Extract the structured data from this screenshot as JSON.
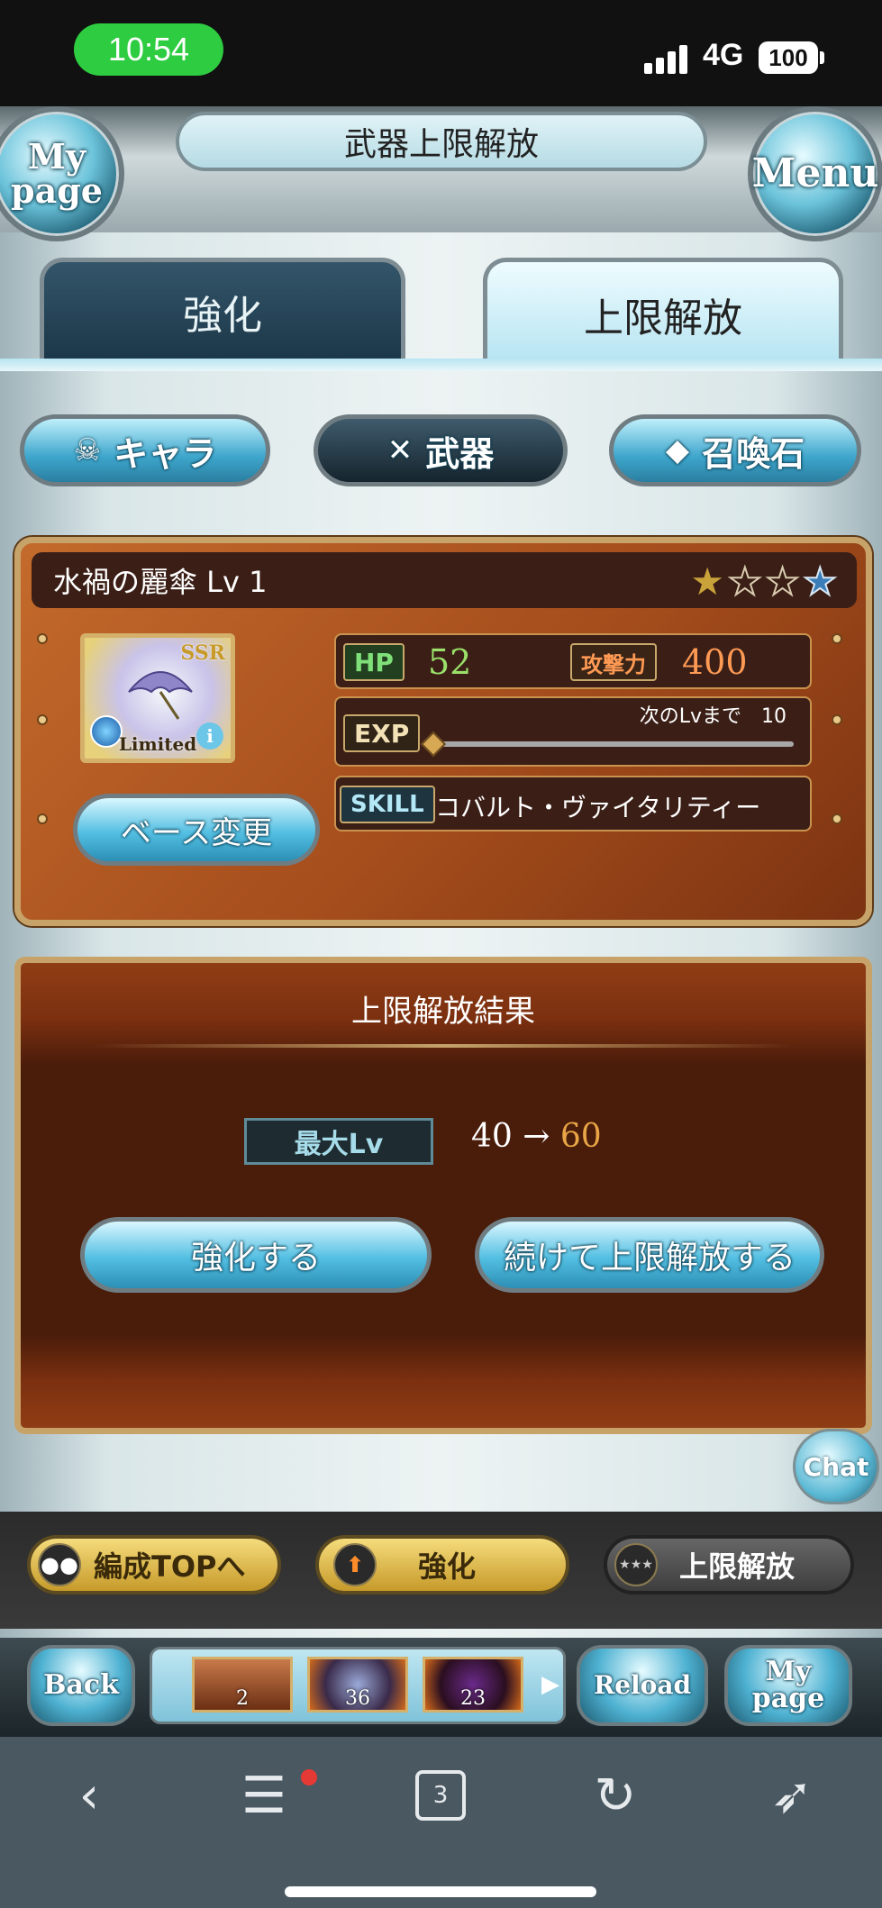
{
  "status": {
    "time": "10:54",
    "network": "4G",
    "battery": "100"
  },
  "header": {
    "title": "武器上限解放",
    "left_orb": "My page",
    "right_orb": "Menu"
  },
  "tabs": [
    {
      "label": "強化",
      "active": false
    },
    {
      "label": "上限解放",
      "active": true
    }
  ],
  "filters": [
    {
      "label": "キャラ",
      "icon": "chara-icon"
    },
    {
      "label": "武器",
      "icon": "crossed-swords-icon",
      "selected": true
    },
    {
      "label": "召喚石",
      "icon": "crystal-icon"
    }
  ],
  "weapon": {
    "name": "水禍の麗傘 Lv 1",
    "rarity_badge": "SSR",
    "limited_label": "Limited",
    "uncap_stars": {
      "filled": 1,
      "total": 4
    },
    "hp_label": "HP",
    "hp": "52",
    "atk_label": "攻撃力",
    "atk": "400",
    "exp_label": "EXP",
    "next_lv_text": "次のLvまで　10",
    "exp_progress": 0.0,
    "skill_label": "SKILL",
    "skill": "コバルト・ヴァイタリティー",
    "base_change_label": "ベース変更"
  },
  "result": {
    "title": "上限解放結果",
    "max_lv_label": "最大Lv",
    "lv_from": "40",
    "arrow": "→",
    "lv_to": "60",
    "enhance_button": "強化する",
    "continue_button": "続けて上限解放する"
  },
  "chat_label": "Chat",
  "bottom_nav": [
    {
      "label": "編成TOPへ"
    },
    {
      "label": "強化"
    },
    {
      "label": "上限解放"
    }
  ],
  "footer": {
    "back": "Back",
    "reload": "Reload",
    "mypage": "My page",
    "items": [
      "2",
      "36",
      "23"
    ]
  },
  "browser": {
    "tab_count": "3"
  },
  "colors": {
    "accent_blue": "#53bfe2",
    "panel_brown": "#a54d1c",
    "gold": "#c79a2a",
    "hp_green": "#9ae06a",
    "atk_orange": "#ff9a54",
    "lv_to_orange": "#e9a646"
  }
}
